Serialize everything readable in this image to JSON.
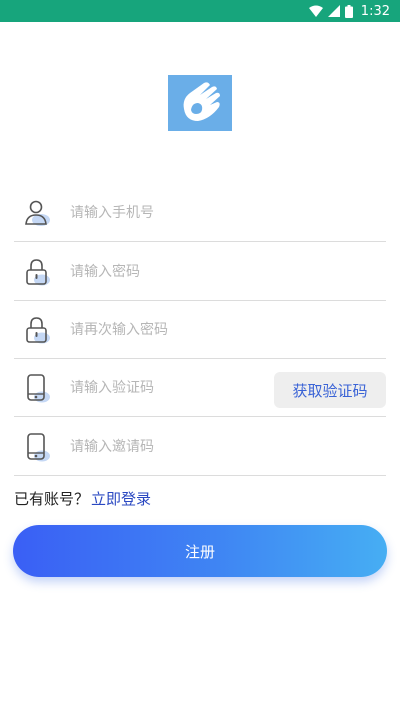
{
  "status_bar": {
    "time": "1:32",
    "background": "#17a57c",
    "icons": [
      "wifi-icon",
      "signal-icon",
      "battery-icon"
    ]
  },
  "logo": {
    "icon": "hand-logo-icon",
    "color": "#6aaee8"
  },
  "form": {
    "phone": {
      "placeholder": "请输入手机号",
      "icon": "user-icon"
    },
    "password": {
      "placeholder": "请输入密码",
      "icon": "lock-icon"
    },
    "password_confirm": {
      "placeholder": "请再次输入密码",
      "icon": "lock-icon"
    },
    "verify_code": {
      "placeholder": "请输入验证码",
      "icon": "phone-icon",
      "button_label": "获取验证码"
    },
    "invite_code": {
      "placeholder": "请输入邀请码",
      "icon": "phone-icon"
    }
  },
  "login_prompt": {
    "text": "已有账号？",
    "link": "立即登录"
  },
  "register_button": {
    "label": "注册",
    "gradient": [
      "#3a5ff5",
      "#46aef3"
    ]
  },
  "colors": {
    "placeholder": "#b6b6b6",
    "link": "#2a48c2",
    "accent_blue": "#3a63d6",
    "icon_shadow": "#c5d8f5"
  }
}
